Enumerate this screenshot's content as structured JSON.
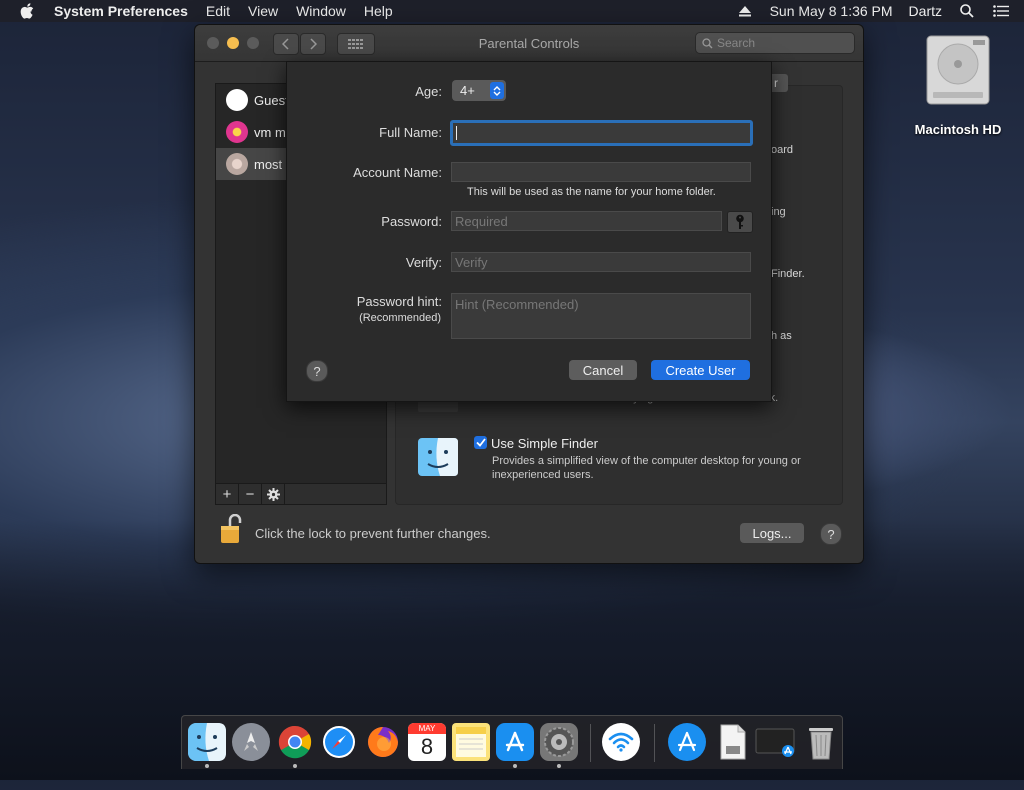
{
  "menubar": {
    "app_name": "System Preferences",
    "items": [
      "Edit",
      "View",
      "Window",
      "Help"
    ],
    "clock": "Sun May 8  1:36 PM",
    "user": "Dartz"
  },
  "desktop": {
    "hd_label": "Macintosh HD"
  },
  "window": {
    "title": "Parental Controls",
    "search_placeholder": "Search",
    "users": [
      {
        "name": "Guest",
        "color": "#ffffff"
      },
      {
        "name": "vm ma",
        "color": "#e0358f"
      },
      {
        "name": "most r",
        "color": "#b9a7a0"
      }
    ],
    "list_buttons": [
      "+",
      "−"
    ],
    "right_fragments": {
      "stub_button": "r",
      "frag1": "oard",
      "frag2": "ing",
      "frag3": "Finder.",
      "frag4": "h as",
      "frag5": "Prevents the user from modifying the contents of the Dock."
    },
    "simple_finder": {
      "title": "Use Simple Finder",
      "description": "Provides a simplified view of the computer desktop for young or inexperienced users."
    },
    "lock_text": "Click the lock to prevent further changes.",
    "logs_button": "Logs...",
    "help": "?"
  },
  "sheet": {
    "age_label": "Age:",
    "age_value": "4+",
    "full_name_label": "Full Name:",
    "account_name_label": "Account Name:",
    "account_hint": "This will be used as the name for your home folder.",
    "password_label": "Password:",
    "password_placeholder": "Required",
    "verify_label": "Verify:",
    "verify_placeholder": "Verify",
    "hint_label": "Password hint:",
    "hint_sublabel": "(Recommended)",
    "hint_placeholder": "Hint (Recommended)",
    "help": "?",
    "cancel": "Cancel",
    "create": "Create User",
    "accent": "#1f6fe0"
  },
  "dock": {
    "calendar_month": "MAY",
    "calendar_day": "8",
    "apps": [
      "finder-icon",
      "launchpad-icon",
      "chrome-icon",
      "safari-icon",
      "firefox-icon",
      "calendar-icon",
      "notes-icon",
      "app-store-icon",
      "system-preferences-icon",
      "wifi-utility-icon",
      "app-store-download-icon",
      "document-icon",
      "screen-icon",
      "trash-icon"
    ]
  }
}
